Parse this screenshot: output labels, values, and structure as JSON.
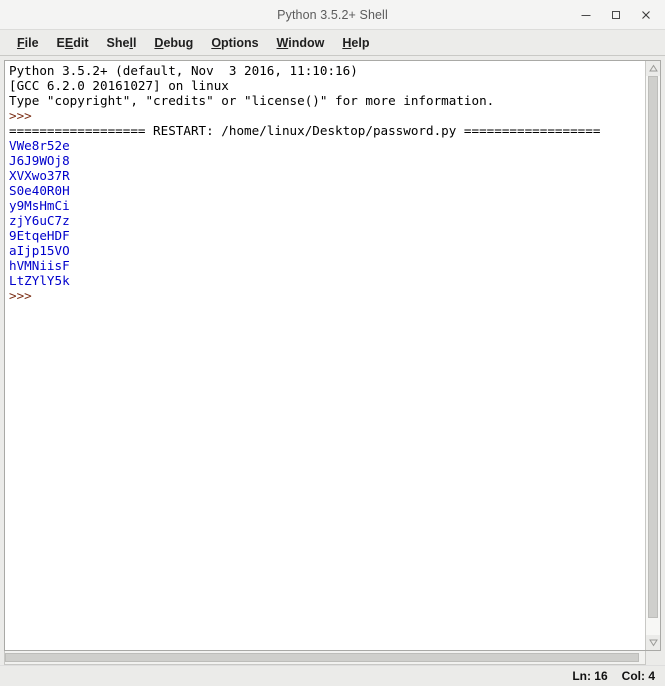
{
  "window": {
    "title": "Python 3.5.2+ Shell",
    "controls": {
      "minimize": "minimize-icon",
      "maximize": "maximize-icon",
      "close": "close-icon"
    }
  },
  "menubar": {
    "items": [
      {
        "label": "File",
        "accel": "F"
      },
      {
        "label": "Edit",
        "accel": "E"
      },
      {
        "label": "Shell",
        "accel": "l"
      },
      {
        "label": "Debug",
        "accel": "D"
      },
      {
        "label": "Options",
        "accel": "O"
      },
      {
        "label": "Window",
        "accel": "W"
      },
      {
        "label": "Help",
        "accel": "H"
      }
    ]
  },
  "console": {
    "lines": [
      {
        "text": "Python 3.5.2+ (default, Nov  3 2016, 11:10:16)",
        "style": "normal"
      },
      {
        "text": "[GCC 6.2.0 20161027] on linux",
        "style": "normal"
      },
      {
        "text": "Type \"copyright\", \"credits\" or \"license()\" for more information.",
        "style": "normal"
      },
      {
        "text": ">>> ",
        "style": "prompt"
      },
      {
        "text": "================== RESTART: /home/linux/Desktop/password.py ==================",
        "style": "restart"
      },
      {
        "text": "VWe8r52e",
        "style": "stdout"
      },
      {
        "text": "J6J9WOj8",
        "style": "stdout"
      },
      {
        "text": "XVXwo37R",
        "style": "stdout"
      },
      {
        "text": "S0e40R0H",
        "style": "stdout"
      },
      {
        "text": "y9MsHmCi",
        "style": "stdout"
      },
      {
        "text": "zjY6uC7z",
        "style": "stdout"
      },
      {
        "text": "9EtqeHDF",
        "style": "stdout"
      },
      {
        "text": "aIjp15VO",
        "style": "stdout"
      },
      {
        "text": "hVMNiisF",
        "style": "stdout"
      },
      {
        "text": "LtZYlY5k",
        "style": "stdout"
      },
      {
        "text": ">>> ",
        "style": "prompt"
      }
    ],
    "colors": {
      "stdout": "#0000cc",
      "prompt": "#7b2d13",
      "normal": "#000000",
      "background": "#ffffff"
    }
  },
  "statusbar": {
    "line_label": "Ln: 16",
    "col_label": "Col: 4"
  }
}
